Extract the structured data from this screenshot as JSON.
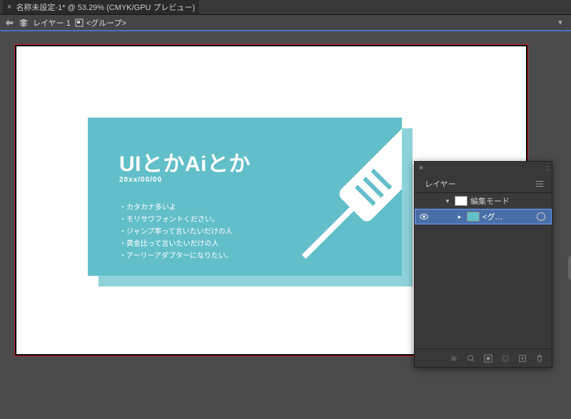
{
  "tab": {
    "title": "名称未設定-1* @ 53.29% (CMYK/GPU プレビュー)"
  },
  "breadcrumb": {
    "layer": "レイヤー 1",
    "selection": "<グループ>"
  },
  "art": {
    "headline": "UIとかAiとか",
    "date": "20xx/00/00",
    "bullets": [
      "カタカナ多いよ",
      "モリサワフォントください。",
      "ジャンプ率って言いたいだけの人",
      "黄金比って言いたいだけの人",
      "アーリーアダプターになりたい。"
    ]
  },
  "panel": {
    "tab_label": "レイヤー",
    "rows": {
      "edit_mode": "編集モード",
      "group": "<グ…"
    },
    "footer_icons": [
      "export-icon",
      "locate-icon",
      "mask-icon",
      "enter-icon",
      "new-layer-icon",
      "trash-icon"
    ]
  }
}
